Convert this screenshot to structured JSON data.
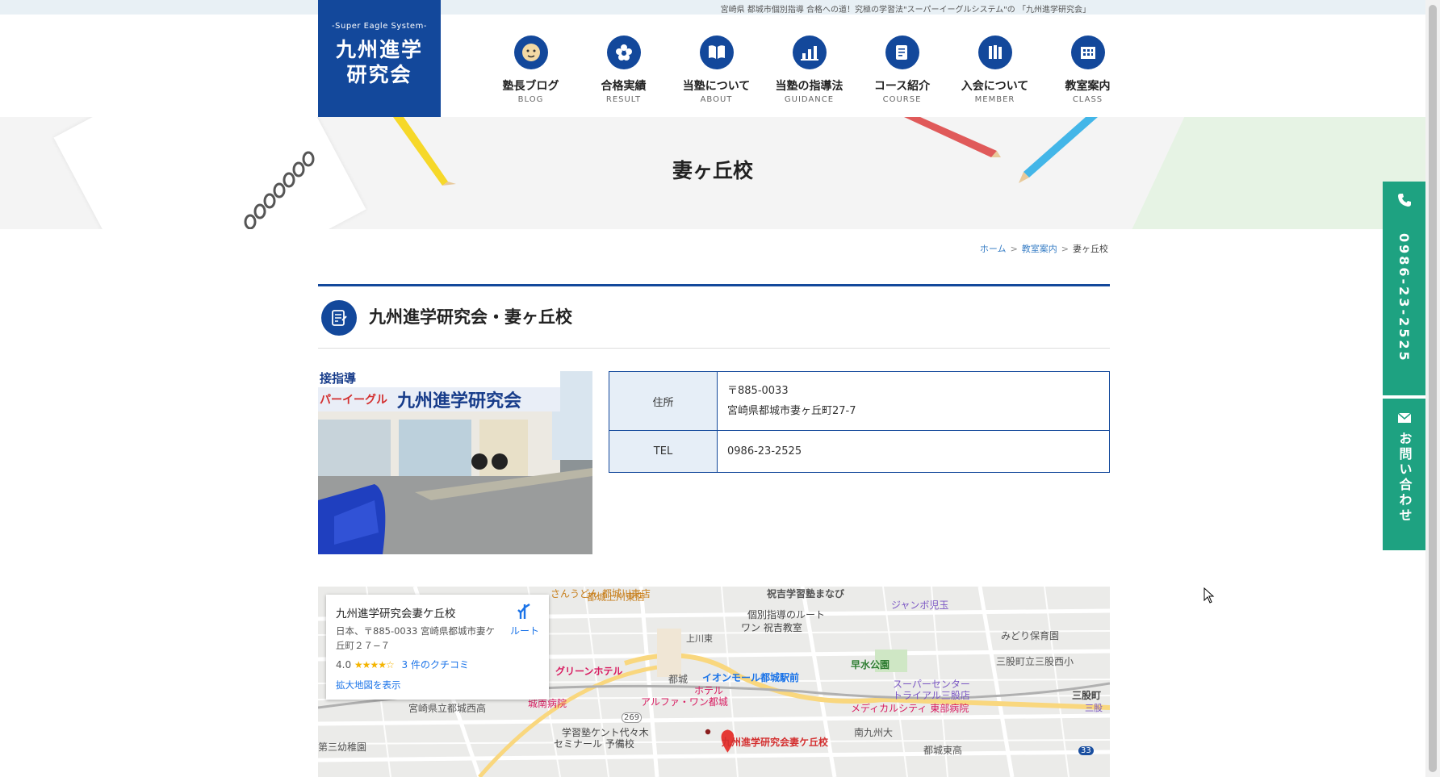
{
  "header": {
    "tagline": "宮崎県 都城市個別指導 合格への道！究極の学習法\"スーパーイーグルシステム\"の 「九州進学研究会」",
    "logo_sub": "-Super Eagle System-",
    "logo_line1": "九州進学",
    "logo_line2": "研究会"
  },
  "nav": [
    {
      "label": "塾長ブログ",
      "en": "BLOG",
      "icon": "face-icon"
    },
    {
      "label": "合格実績",
      "en": "RESULT",
      "icon": "flower-icon"
    },
    {
      "label": "当塾について",
      "en": "ABOUT",
      "icon": "book-icon"
    },
    {
      "label": "当塾の指導法",
      "en": "GUIDANCE",
      "icon": "chart-icon"
    },
    {
      "label": "コース紹介",
      "en": "COURSE",
      "icon": "note-icon"
    },
    {
      "label": "入会について",
      "en": "MEMBER",
      "icon": "books-icon"
    },
    {
      "label": "教室案内",
      "en": "CLASS",
      "icon": "building-icon"
    }
  ],
  "hero": {
    "title": "妻ヶ丘校"
  },
  "breadcrumb": {
    "home": "ホーム",
    "sep": ">",
    "classes": "教室案内",
    "current": "妻ヶ丘校"
  },
  "section": {
    "title": "九州進学研究会・妻ヶ丘校"
  },
  "photo": {
    "sign1": "接指導",
    "sign2": "パーイーグル",
    "sign3": "九州進学研究会"
  },
  "info": {
    "address_label": "住所",
    "postal": "〒885-0033",
    "address": "宮崎県都城市妻ヶ丘町27-7",
    "tel_label": "TEL",
    "tel": "0986-23-2525"
  },
  "map": {
    "card_title": "九州進学研究会妻ケ丘校",
    "card_address": "日本、〒885-0033 宮崎県都城市妻ケ丘町２７−７",
    "rating": "4.0",
    "stars": "★★★★☆",
    "reviews": "3 件のクチコミ",
    "enlarge": "拡大地図を表示",
    "route": "ルート",
    "labels": [
      "祝吉学習塾まなび",
      "個別指導のルート",
      "ワン 祝吉教室",
      "ジャンボ児玉",
      "都城上川東店",
      "さんうどん 都城川東店",
      "上川東",
      "早水公園",
      "みどり保育園",
      "三股町立三股西小",
      "三股町",
      "三股",
      "グリーンホテル",
      "都城",
      "ホテル",
      "アルファ・ワン都城",
      "イオンモール都城駅前",
      "スーパーセンター",
      "トライアル三股店",
      "メディカルシティ 東部病院",
      "城南病院",
      "宮崎県立都城西高",
      "南九州大",
      "学習塾ケント代々木",
      "セミナール 予備校",
      "九州進学研究会妻ケ丘校",
      "第三幼稚園",
      "都城東高",
      "269",
      "33"
    ]
  },
  "side": {
    "tel": "0986-23-2525",
    "contact": "お問い合わせ"
  },
  "colors": {
    "brand": "#13489b",
    "side": "#1ea281",
    "pin": "#e53935"
  }
}
